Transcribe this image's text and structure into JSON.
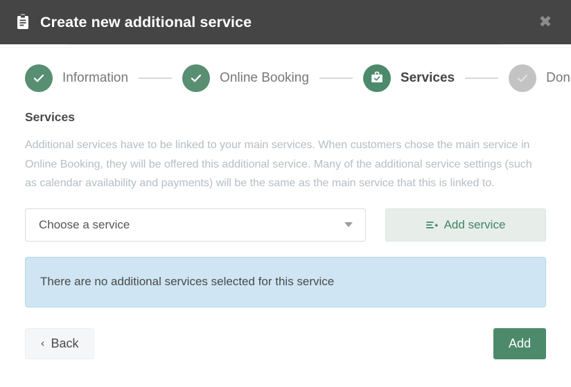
{
  "header": {
    "icon": "clipboard-icon",
    "title": "Create new additional service",
    "close_label": "✖",
    "background_color": "#454545"
  },
  "stepper": {
    "steps": [
      {
        "label": "Information",
        "state": "done",
        "icon": "check-icon"
      },
      {
        "label": "Online Booking",
        "state": "done",
        "icon": "check-icon"
      },
      {
        "label": "Services",
        "state": "current",
        "icon": "briefcase-check-icon"
      },
      {
        "label": "Done",
        "state": "todo",
        "icon": "check-icon"
      }
    ],
    "done_color": "#588e72",
    "current_color": "#4d8a6b",
    "todo_color": "#c3c3c3"
  },
  "section": {
    "title": "Services",
    "description": "Additional services have to be linked to your main services. When customers chose the main service in Online Booking, they will be offered this additional service. Many of the additional service settings (such as calendar availability and payments) will be the same as the main service that this is linked to."
  },
  "service_select": {
    "value": "Choose a service",
    "placeholder": "Choose a service",
    "caret_icon": "chevron-down-icon"
  },
  "add_service_button": {
    "label": "Add service",
    "icon": "list-plus-icon",
    "text_color": "#3f8263",
    "background_color": "#e7eeea"
  },
  "alert": {
    "message": "There are no additional services selected for this service",
    "background_color": "#cfe5f3",
    "border_color": "#b3d5ea"
  },
  "footer": {
    "back_label": "Back",
    "back_icon": "chevron-left-icon",
    "submit_label": "Add",
    "submit_color": "#4d8a6b"
  }
}
